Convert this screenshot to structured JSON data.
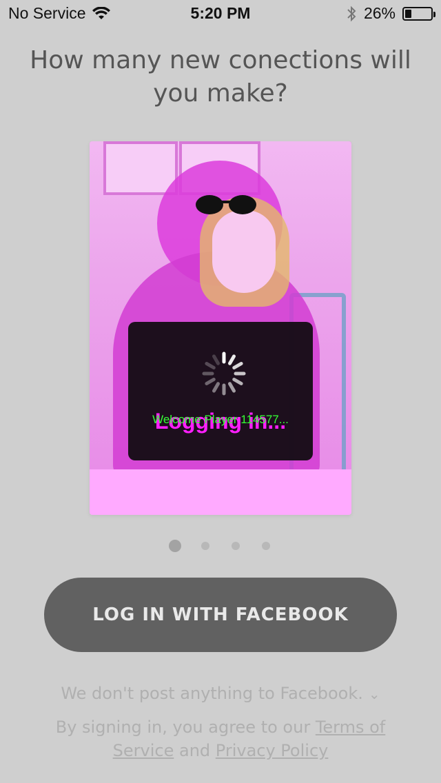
{
  "status_bar": {
    "carrier": "No Service",
    "time": "5:20 PM",
    "battery_percent": "26%",
    "battery_level": 0.26,
    "icons": [
      "wifi-icon",
      "bluetooth-icon",
      "battery-icon"
    ]
  },
  "headline": "How many new conections will you make?",
  "card": {
    "loading_text": "Logging in...",
    "welcome_text": "Welcome Player 114577..."
  },
  "pager": {
    "count": 4,
    "active_index": 0
  },
  "fb_button_label": "LOG IN WITH FACEBOOK",
  "no_post_text": "We don't post anything to Facebook.",
  "terms": {
    "prefix": "By signing in, you agree to our ",
    "terms_link": "Terms of Service",
    "middle": " and ",
    "privacy_link": "Privacy Policy"
  },
  "colors": {
    "background": "#cfcfcf",
    "button": "#616161",
    "loading_text": "#ff1fff",
    "welcome_text": "#35ff35",
    "card": "#ffaaff"
  }
}
